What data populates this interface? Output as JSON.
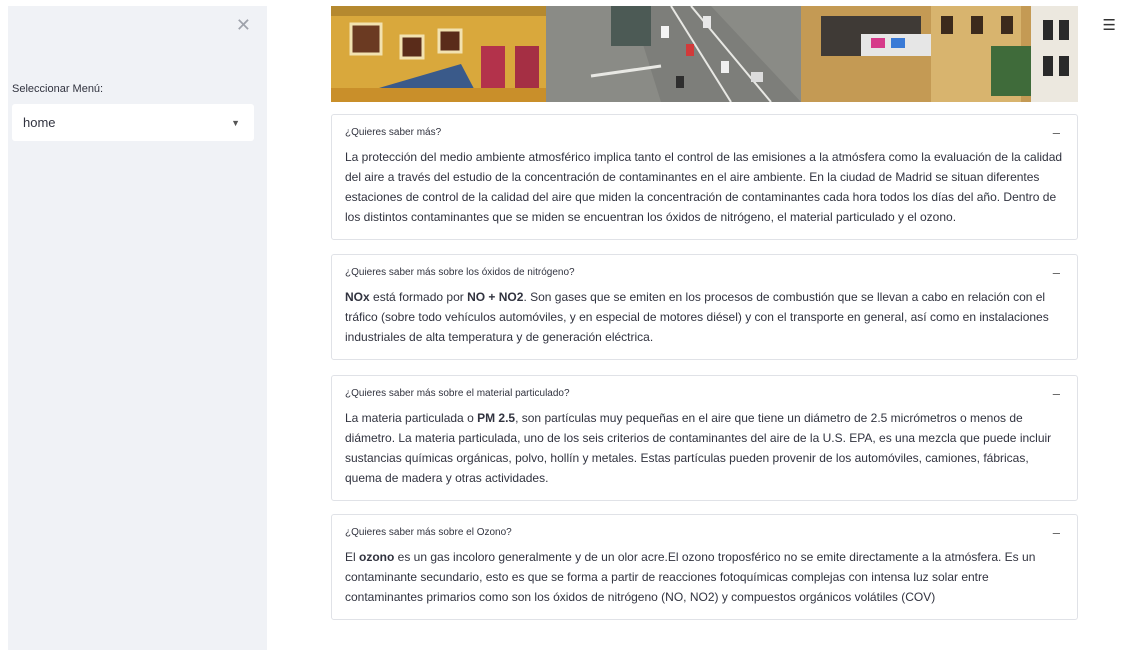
{
  "sidebar": {
    "menu_label": "Seleccionar Menú:",
    "select_value": "home"
  },
  "expanders": [
    {
      "title": "¿Quieres saber más?",
      "text": "La protección del medio ambiente atmosférico implica tanto el control de las emisiones a la atmósfera como la evaluación de la calidad del aire a través del estudio de la concentración de contaminantes en el aire ambiente. En la ciudad de Madrid se situan diferentes estaciones de control de la calidad del aire que miden la concentración de contaminantes cada hora todos los días del año. Dentro de los distintos contaminantes que se miden se encuentran los óxidos de nitrógeno, el material particulado y el ozono."
    },
    {
      "title": "¿Quieres saber más sobre los óxidos de nitrógeno?",
      "bold1": "NOx",
      "mid1": " está formado por ",
      "bold2": "NO + NO2",
      "rest": ". Son gases que se emiten en los procesos de combustión que se llevan a cabo en relación con el tráfico (sobre todo vehículos automóviles, y en especial de motores diésel) y con el transporte en general, así como en instalaciones industriales de alta temperatura y de generación eléctrica."
    },
    {
      "title": "¿Quieres saber más sobre el material particulado?",
      "pre": "La materia particulada o ",
      "bold": "PM 2.5",
      "rest": ", son partículas muy pequeñas en el aire que tiene un diámetro de 2.5 micrómetros o menos de diámetro. La materia particulada, uno de los seis criterios de contaminantes del aire de la U.S. EPA, es una mezcla que puede incluir sustancias químicas orgánicas, polvo, hollín y metales. Estas partículas pueden provenir de los automóviles, camiones, fábricas, quema de madera y otras actividades."
    },
    {
      "title": "¿Quieres saber más sobre el Ozono?",
      "pre": "El ",
      "bold": "ozono",
      "rest": " es un gas incoloro generalmente y de un olor acre.El ozono troposférico no se emite directamente a la atmósfera. Es un contaminante secundario, esto es que se forma a partir de reacciones fotoquímicas complejas con intensa luz solar entre contaminantes primarios como son los óxidos de nitrógeno (NO, NO2) y compuestos orgánicos volátiles (COV)"
    }
  ]
}
